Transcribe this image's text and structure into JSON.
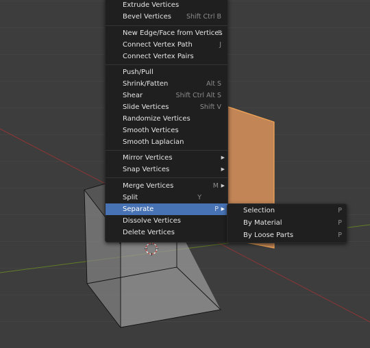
{
  "menu": {
    "items": [
      {
        "label": "Extrude Vertices",
        "shortcut": ""
      },
      {
        "label": "Bevel Vertices",
        "shortcut": "Shift Ctrl B"
      },
      {
        "label": "New Edge/Face from Vertices",
        "shortcut": "F"
      },
      {
        "label": "Connect Vertex Path",
        "shortcut": "J"
      },
      {
        "label": "Connect Vertex Pairs",
        "shortcut": ""
      },
      {
        "label": "Push/Pull",
        "shortcut": ""
      },
      {
        "label": "Shrink/Fatten",
        "shortcut": "Alt S"
      },
      {
        "label": "Shear",
        "shortcut": "Shift Ctrl Alt S"
      },
      {
        "label": "Slide Vertices",
        "shortcut": "Shift V"
      },
      {
        "label": "Randomize Vertices",
        "shortcut": ""
      },
      {
        "label": "Smooth Vertices",
        "shortcut": ""
      },
      {
        "label": "Smooth Laplacian",
        "shortcut": ""
      },
      {
        "label": "Mirror Vertices",
        "shortcut": ""
      },
      {
        "label": "Snap Vertices",
        "shortcut": ""
      },
      {
        "label": "Merge Vertices",
        "shortcut": "M"
      },
      {
        "label": "Split",
        "shortcut": "Y"
      },
      {
        "label": "Separate",
        "shortcut": "P"
      },
      {
        "label": "Dissolve Vertices",
        "shortcut": ""
      },
      {
        "label": "Delete Vertices",
        "shortcut": ""
      }
    ]
  },
  "submenu": {
    "items": [
      {
        "label": "Selection",
        "shortcut": "P"
      },
      {
        "label": "By Material",
        "shortcut": "P"
      },
      {
        "label": "By Loose Parts",
        "shortcut": "P"
      }
    ]
  },
  "colors": {
    "highlight": "#4772b3",
    "menu_bg": "#1f1f1f",
    "selected_face": "#e0995e",
    "x_axis": "#9b3a3a",
    "y_axis": "#6b8c2c"
  },
  "icons": {
    "submenu_arrow": "triangle-right-icon",
    "cursor": "3d-cursor-icon"
  }
}
